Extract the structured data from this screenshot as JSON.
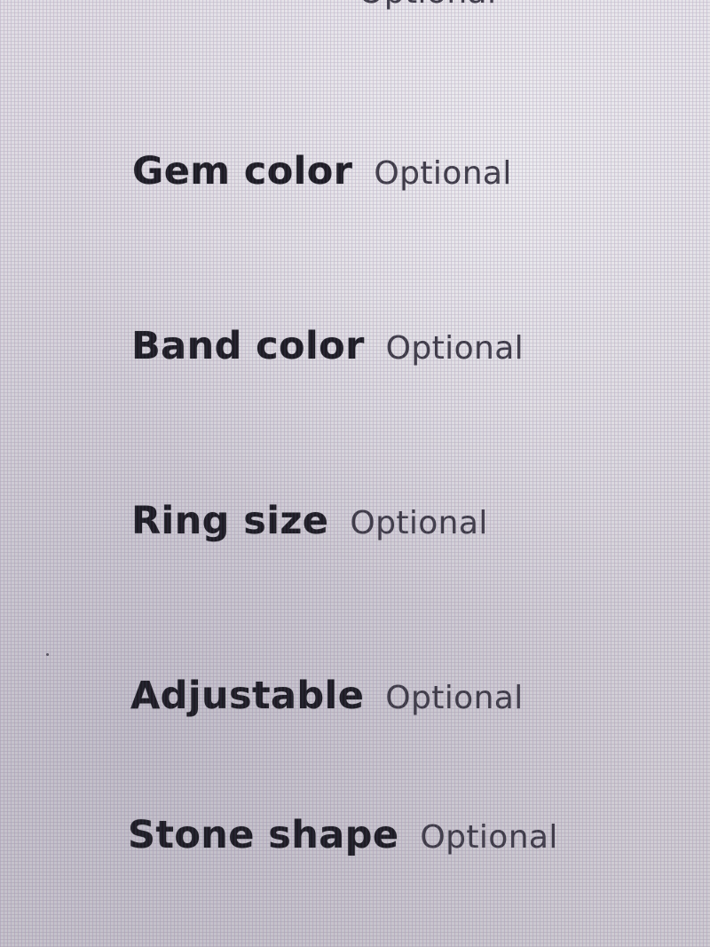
{
  "form": {
    "fields": [
      {
        "label": "Gem color",
        "optional": "Optional"
      },
      {
        "label": "Band color",
        "optional": "Optional"
      },
      {
        "label": "Ring size",
        "optional": "Optional"
      },
      {
        "label": "Adjustable",
        "optional": "Optional"
      },
      {
        "label": "Stone shape",
        "optional": "Optional"
      }
    ],
    "partial_top": {
      "label": "",
      "optional": "Optional"
    }
  }
}
